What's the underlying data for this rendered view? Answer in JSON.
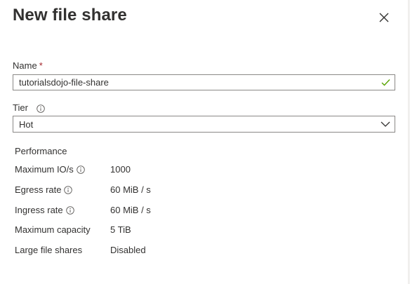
{
  "dialog": {
    "title": "New file share",
    "close_icon": "close-icon"
  },
  "name_field": {
    "label": "Name",
    "required_marker": "*",
    "value": "tutorialsdojo-file-share",
    "valid_icon": "checkmark-icon",
    "valid_color": "#57a300"
  },
  "tier_field": {
    "label": "Tier",
    "info_icon": "info-icon",
    "selected": "Hot",
    "dropdown_icon": "chevron-down-icon"
  },
  "performance": {
    "heading": "Performance",
    "rows": [
      {
        "label": "Maximum IO/s",
        "value": "1000",
        "has_info": true
      },
      {
        "label": "Egress rate",
        "value": "60 MiB / s",
        "has_info": true
      },
      {
        "label": "Ingress rate",
        "value": "60 MiB / s",
        "has_info": true
      },
      {
        "label": "Maximum capacity",
        "value": "5 TiB",
        "has_info": false
      },
      {
        "label": "Large file shares",
        "value": "Disabled",
        "has_info": false
      }
    ]
  }
}
